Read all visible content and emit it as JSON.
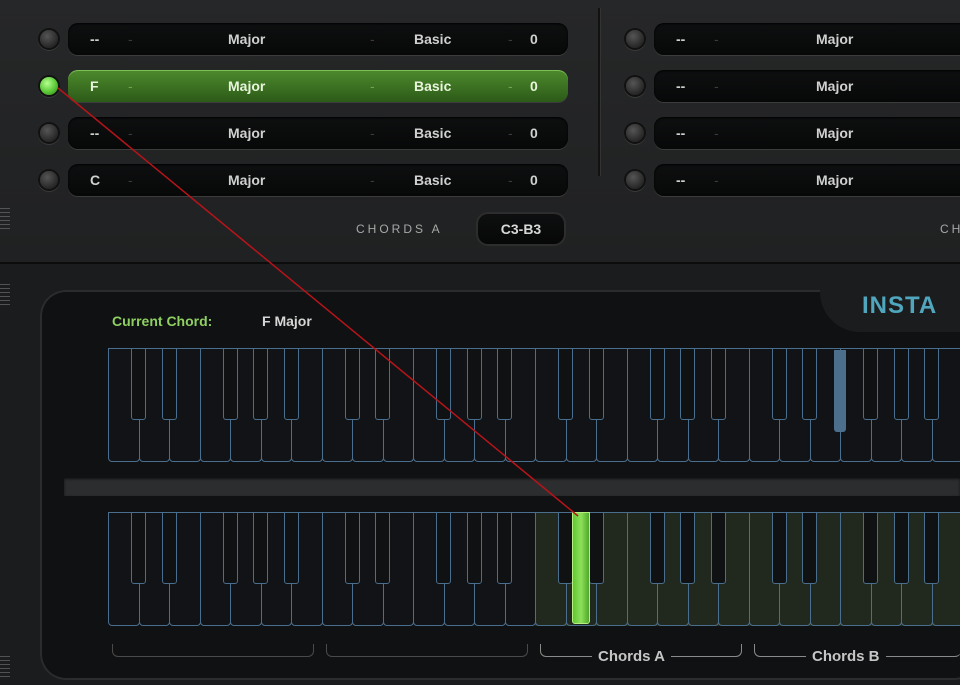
{
  "rows_a": [
    {
      "root": "--",
      "type": "Major",
      "voicing": "Basic",
      "value": "0",
      "led_on": false,
      "active": false
    },
    {
      "root": "F",
      "type": "Major",
      "voicing": "Basic",
      "value": "0",
      "led_on": true,
      "active": true
    },
    {
      "root": "--",
      "type": "Major",
      "voicing": "Basic",
      "value": "0",
      "led_on": false,
      "active": false
    },
    {
      "root": "C",
      "type": "Major",
      "voicing": "Basic",
      "value": "0",
      "led_on": false,
      "active": false
    }
  ],
  "rows_b": [
    {
      "root": "--",
      "type": "Major"
    },
    {
      "root": "--",
      "type": "Major"
    },
    {
      "root": "--",
      "type": "Major"
    },
    {
      "root": "--",
      "type": "Major"
    }
  ],
  "separator_dash": "-",
  "chords_a": {
    "label": "CHORDS A",
    "range": "C3-B3"
  },
  "chords_b_partial": "CH",
  "brand_partial": "INSTA",
  "current_chord": {
    "label": "Current Chord:",
    "value": "F Major"
  },
  "brackets": {
    "a": "Chords A",
    "b": "Chords B"
  },
  "colors": {
    "accent_green": "#8fd062",
    "active_row": "#3f7a22",
    "key_outline": "#4a6f8e",
    "brand": "#4fa6bd",
    "annotation_line": "#b8141a"
  }
}
